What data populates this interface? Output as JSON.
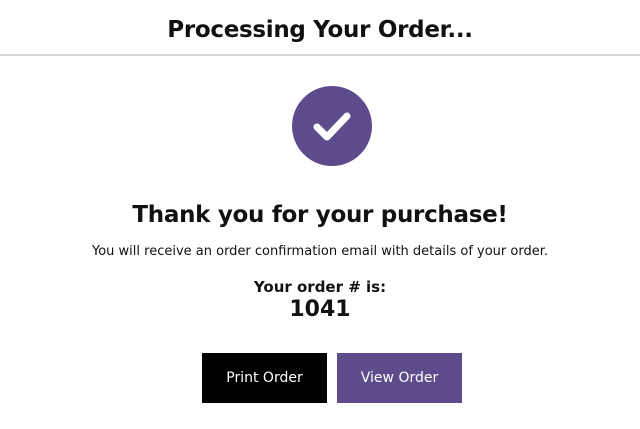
{
  "header": {
    "title": "Processing Your Order..."
  },
  "status_icon": "checkmark-icon",
  "colors": {
    "accent": "#5e4b8b",
    "print_button_bg": "#000000",
    "text": "#111111"
  },
  "confirmation": {
    "heading": "Thank you for your purchase!",
    "message": "You will receive an order confirmation email with details of your order.",
    "order_label": "Your order # is:",
    "order_number": "1041"
  },
  "actions": {
    "print_label": "Print Order",
    "view_label": "View Order"
  }
}
